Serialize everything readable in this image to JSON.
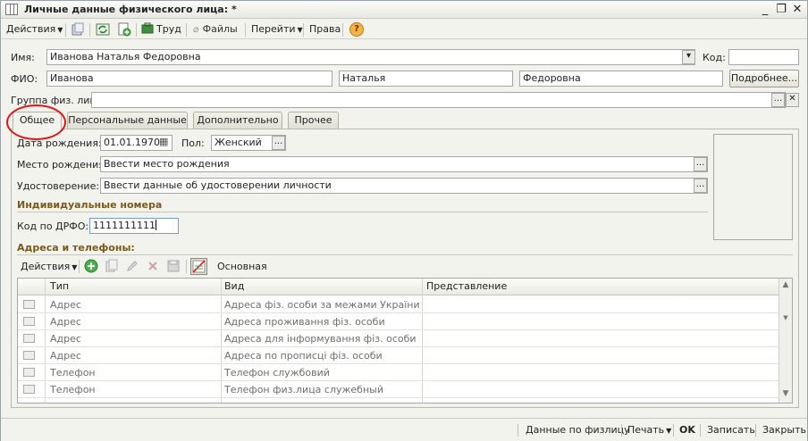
{
  "window": {
    "title": "Личные данные физического лица: *",
    "controls": [
      "_",
      "❐",
      "✕"
    ]
  },
  "toolbar": {
    "actions_label": "Действия",
    "work_label": "Труд",
    "files_label": "Файлы",
    "goto_label": "Перейти",
    "rights_label": "Права",
    "help_label": "?"
  },
  "header": {
    "name_label": "Имя:",
    "name_value": "Иванова Наталья Федоровна",
    "code_label": "Код:",
    "code_value": "",
    "fio_label": "ФИО:",
    "last_name": "Иванова",
    "first_name": "Наталья",
    "middle_name": "Федоровна",
    "more_button": "Подробнее...",
    "group_label": "Группа физ. лиц:",
    "group_value": "",
    "ellipsis": "...",
    "clear": "✕"
  },
  "tabs": [
    {
      "label": "Общее",
      "active": true
    },
    {
      "label": "Персональные данные",
      "active": false
    },
    {
      "label": "Дополнительно",
      "active": false
    },
    {
      "label": "Прочее",
      "active": false
    }
  ],
  "general": {
    "birth_date_label": "Дата рождения:",
    "birth_date_value": "01.01.1970",
    "sex_label": "Пол:",
    "sex_value": "Женский",
    "birth_place_label": "Место рождения:",
    "birth_place_value": "Ввести место рождения",
    "id_doc_label": "Удостоверение:",
    "id_doc_value": "Ввести данные об удостоверении личности",
    "individual_numbers_section": "Индивидуальные номера",
    "drfo_label": "Код по ДРФО:",
    "drfo_value": "1111111111",
    "addresses_section": "Адреса и телефоны:"
  },
  "addresses_toolbar": {
    "actions_label": "Действия",
    "main_label": "Основная"
  },
  "addresses_table": {
    "columns": [
      "Тип",
      "Вид",
      "Представление"
    ],
    "rows": [
      {
        "type": "Адрес",
        "kind": "Адреса фіз. особи за межами України",
        "repr": ""
      },
      {
        "type": "Адрес",
        "kind": "Адреса проживання фіз. особи",
        "repr": ""
      },
      {
        "type": "Адрес",
        "kind": "Адреса для інформування фіз. особи",
        "repr": ""
      },
      {
        "type": "Адрес",
        "kind": "Адреса по прописці фіз. особи",
        "repr": ""
      },
      {
        "type": "Телефон",
        "kind": "Телефон службовий",
        "repr": ""
      },
      {
        "type": "Телефон",
        "kind": "Телефон физ.лица служебный",
        "repr": ""
      }
    ]
  },
  "statusbar": {
    "data_by_person": "Данные по физлицу",
    "print_label": "Печать",
    "ok_label": "OK",
    "save_label": "Записать",
    "close_label": "Закрыть"
  },
  "colors": {
    "section_title": "#7a5a1a",
    "highlight_circle": "#e01414",
    "window_bg": "#f3f3ee"
  }
}
